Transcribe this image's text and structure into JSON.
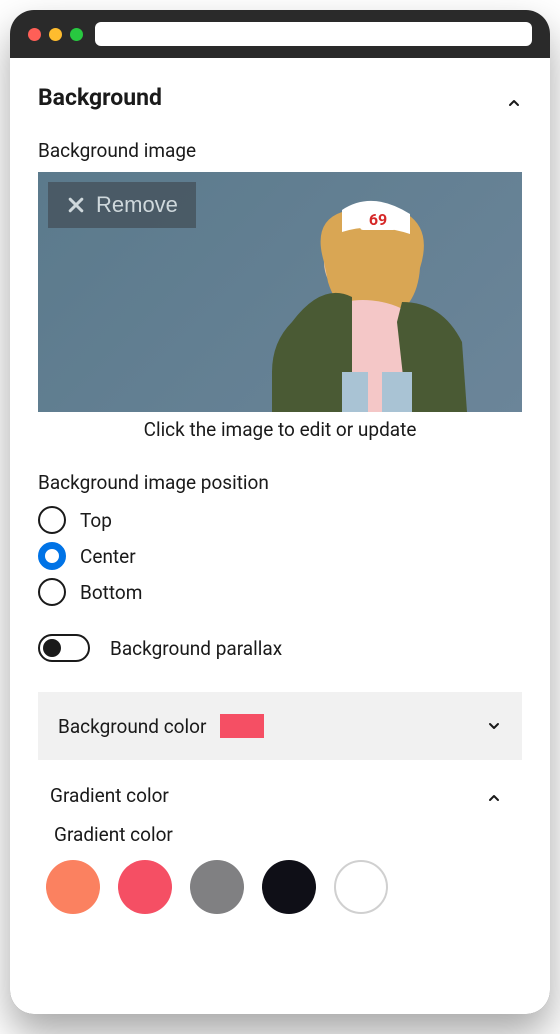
{
  "section": {
    "title": "Background"
  },
  "bgImage": {
    "label": "Background image",
    "removeLabel": "Remove",
    "caption": "Click the image to edit or update"
  },
  "position": {
    "label": "Background image position",
    "options": [
      {
        "label": "Top",
        "selected": false
      },
      {
        "label": "Center",
        "selected": true
      },
      {
        "label": "Bottom",
        "selected": false
      }
    ]
  },
  "parallax": {
    "label": "Background parallax",
    "enabled": false
  },
  "bgColor": {
    "label": "Background color",
    "value": "#f54f64"
  },
  "gradient": {
    "header": "Gradient color",
    "label": "Gradient color",
    "swatches": [
      "#fb8160",
      "#f54f64",
      "#808082",
      "#0f0f17",
      "#ffffff"
    ]
  }
}
